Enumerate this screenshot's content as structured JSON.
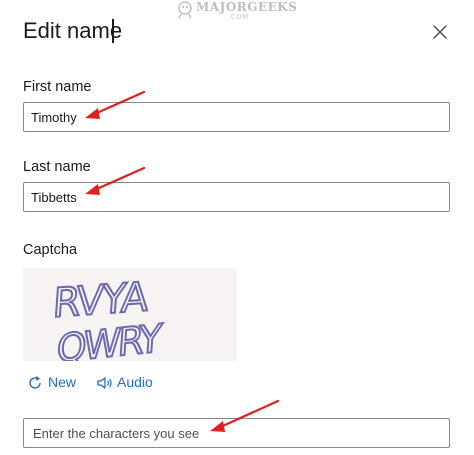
{
  "dialog": {
    "title": "Edit name",
    "close_icon": "close-icon"
  },
  "watermark": {
    "main": "MAJORGEEKS",
    "sub": ".COM"
  },
  "form": {
    "first_name": {
      "label": "First name",
      "value": "Timothy"
    },
    "last_name": {
      "label": "Last name",
      "value": "Tibbetts"
    },
    "captcha": {
      "label": "Captcha",
      "image_text_line1": "RVYA",
      "image_text_line2": "QWRY",
      "new_label": "New",
      "new_icon": "refresh-icon",
      "audio_label": "Audio",
      "audio_icon": "speaker-icon",
      "input_placeholder": "Enter the characters you see"
    }
  },
  "colors": {
    "link": "#1d6fc2",
    "annotation_arrow": "#e02020",
    "field_border": "#8a8a8a",
    "captcha_bg": "#f7f3f3",
    "captcha_glyph": "#6b6ab0"
  }
}
